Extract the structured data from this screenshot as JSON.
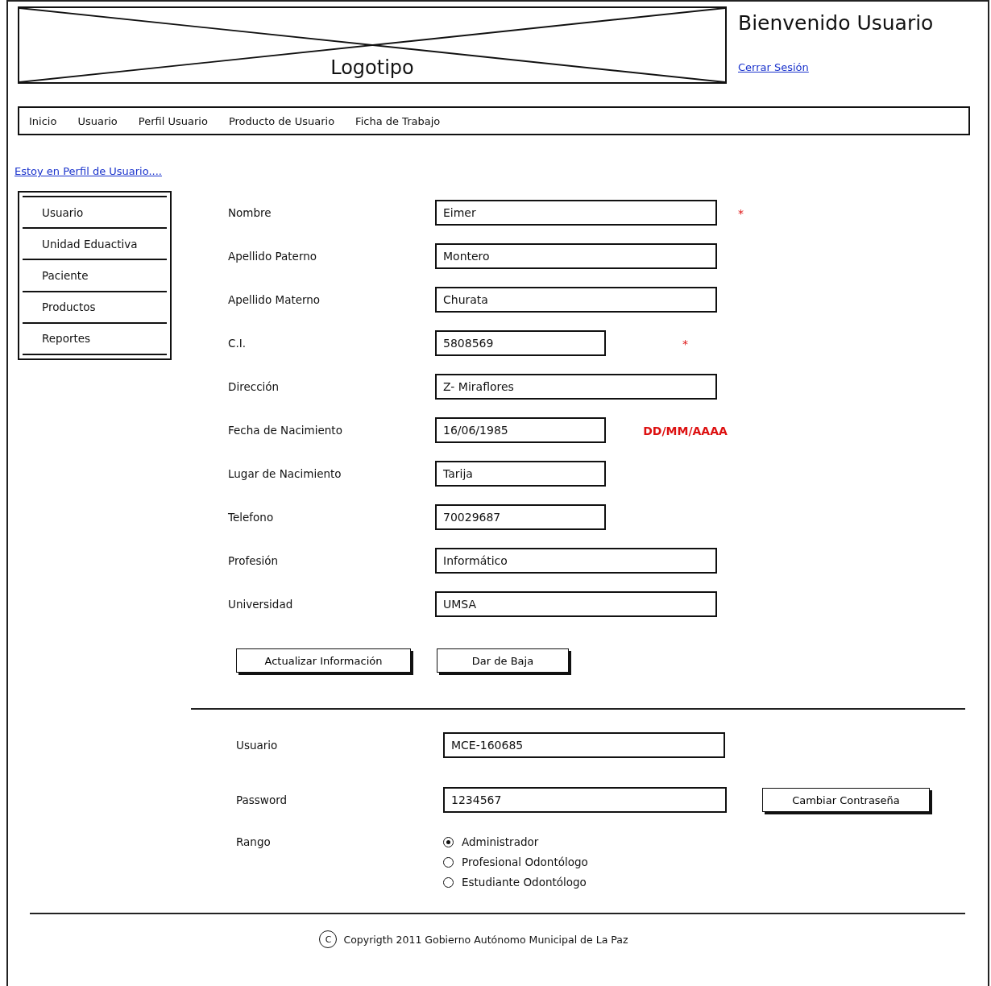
{
  "header": {
    "logo": "Logotipo",
    "welcome": "Bienvenido Usuario",
    "logout": "Cerrar Sesión"
  },
  "nav": [
    "Inicio",
    "Usuario",
    "Perfil Usuario",
    "Producto de Usuario",
    "Ficha de Trabajo"
  ],
  "breadcrumb": "Estoy en Perfil de Usuario....",
  "sidebar": {
    "items": [
      "Usuario",
      "Unidad Eduactiva",
      "Paciente",
      "Productos",
      "Reportes"
    ]
  },
  "profile_form": {
    "fields": [
      {
        "label": "Nombre",
        "value": "Eimer",
        "kind": "wide",
        "required": true
      },
      {
        "label": "Apellido Paterno",
        "value": "Montero",
        "kind": "wide",
        "required": false
      },
      {
        "label": "Apellido Materno",
        "value": "Churata",
        "kind": "wide",
        "required": false
      },
      {
        "label": "C.I.",
        "value": "5808569",
        "kind": "short",
        "required": true
      },
      {
        "label": "Dirección",
        "value": "Z- Miraflores",
        "kind": "wide",
        "required": false
      },
      {
        "label": "Fecha de Nacimiento",
        "value": "16/06/1985",
        "kind": "short",
        "required": false,
        "hint": "DD/MM/AAAA"
      },
      {
        "label": "Lugar de Nacimiento",
        "value": "Tarija",
        "kind": "short",
        "required": false
      },
      {
        "label": "Telefono",
        "value": "70029687",
        "kind": "short",
        "required": false
      },
      {
        "label": "Profesión",
        "value": "Informático",
        "kind": "wide",
        "required": false
      },
      {
        "label": "Universidad",
        "value": "UMSA",
        "kind": "wide",
        "required": false
      }
    ],
    "required_mark": "*",
    "buttons": [
      "Actualizar Información",
      "Dar de Baja"
    ]
  },
  "account_form": {
    "user_label": "Usuario",
    "user_value": "MCE-160685",
    "password_label": "Password",
    "password_value": "1234567",
    "change_password": "Cambiar Contraseña",
    "rank_label": "Rango",
    "ranks": [
      {
        "label": "Administrador",
        "selected": true
      },
      {
        "label": "Profesional Odontólogo",
        "selected": false
      },
      {
        "label": "Estudiante Odontólogo",
        "selected": false
      }
    ]
  },
  "footer": {
    "symbol": "C",
    "text": "Copyrigth 2011 Gobierno Autónomo Municipal de La Paz"
  }
}
